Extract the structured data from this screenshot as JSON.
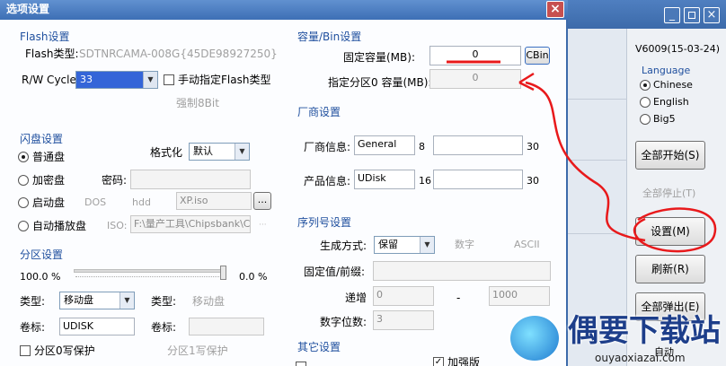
{
  "dialog": {
    "title": "选项设置",
    "close_glyph": "×"
  },
  "flash": {
    "section": "Flash设置",
    "type_label": "Flash类型:",
    "type_value": "SDTNRCAMA-008G{45DE98927250}",
    "rw_label": "R/W Cycle:",
    "rw_value": "33",
    "manual_label": "手动指定Flash类型",
    "force_label": "强制8Bit"
  },
  "udisk": {
    "section": "闪盘设置",
    "normal": "普通盘",
    "format_label": "格式化",
    "format_value": "默认",
    "encrypted": "加密盘",
    "password_label": "密码:",
    "boot": "启动盘",
    "dos": "DOS",
    "hdd": "hdd",
    "boot_file": "XP.iso",
    "browse": "...",
    "autoplay": "自动播放盘",
    "iso_label": "ISO:",
    "iso_value": "F:\\量产工具\\Chipsbank\\C"
  },
  "partition": {
    "section": "分区设置",
    "left_pct": "100.0 %",
    "right_pct": "0.0 %",
    "type_label1": "类型:",
    "type_value1": "移动盘",
    "type_label2": "类型:",
    "type_value2": "移动盘",
    "vol_label1": "卷标:",
    "vol_value1": "UDISK",
    "vol_label2": "卷标:",
    "protect0": "分区0写保护",
    "protect1": "分区1写保护"
  },
  "capacity": {
    "section": "容量/Bin设置",
    "fixed_label": "固定容量(MB):",
    "fixed_value": "0",
    "cbin": "CBin",
    "part0_label": "指定分区0 容量(MB):",
    "part0_value": "0"
  },
  "vendor": {
    "section": "厂商设置",
    "vendor_label": "厂商信息:",
    "vendor_value": "General",
    "vendor_n1": "8",
    "vendor_n2": "30",
    "product_label": "产品信息:",
    "product_value": "UDisk",
    "product_n1": "16",
    "product_n2": "30"
  },
  "serial": {
    "section": "序列号设置",
    "mode_label": "生成方式:",
    "mode_value": "保留",
    "digit": "数字",
    "ascii": "ASCII",
    "fixed_label": "固定值/前缀:",
    "inc_label": "递增",
    "inc_from": "0",
    "dash": "-",
    "inc_to": "1000",
    "digits_label": "数字位数:",
    "digits_value": "3"
  },
  "other": {
    "section": "其它设置",
    "encrypt_label": "加强版"
  },
  "main_window": {
    "version": "V6009(15-03-24)",
    "language_label": "Language",
    "lang_chinese": "Chinese",
    "lang_english": "English",
    "lang_big5": "Big5",
    "start_all": "全部开始(S)",
    "stop_all": "全部停止(T)",
    "settings": "设置(M)",
    "refresh": "刷新(R)",
    "eject_all": "全部弹出(E)",
    "auto_label": "自动"
  },
  "watermark": {
    "name": "偶要下载站",
    "url": "ouyaoxiazai.com"
  },
  "colors": {
    "accent_blue": "#1f4f9e",
    "close_red": "#c75050",
    "annotation_red": "#e8191b"
  }
}
